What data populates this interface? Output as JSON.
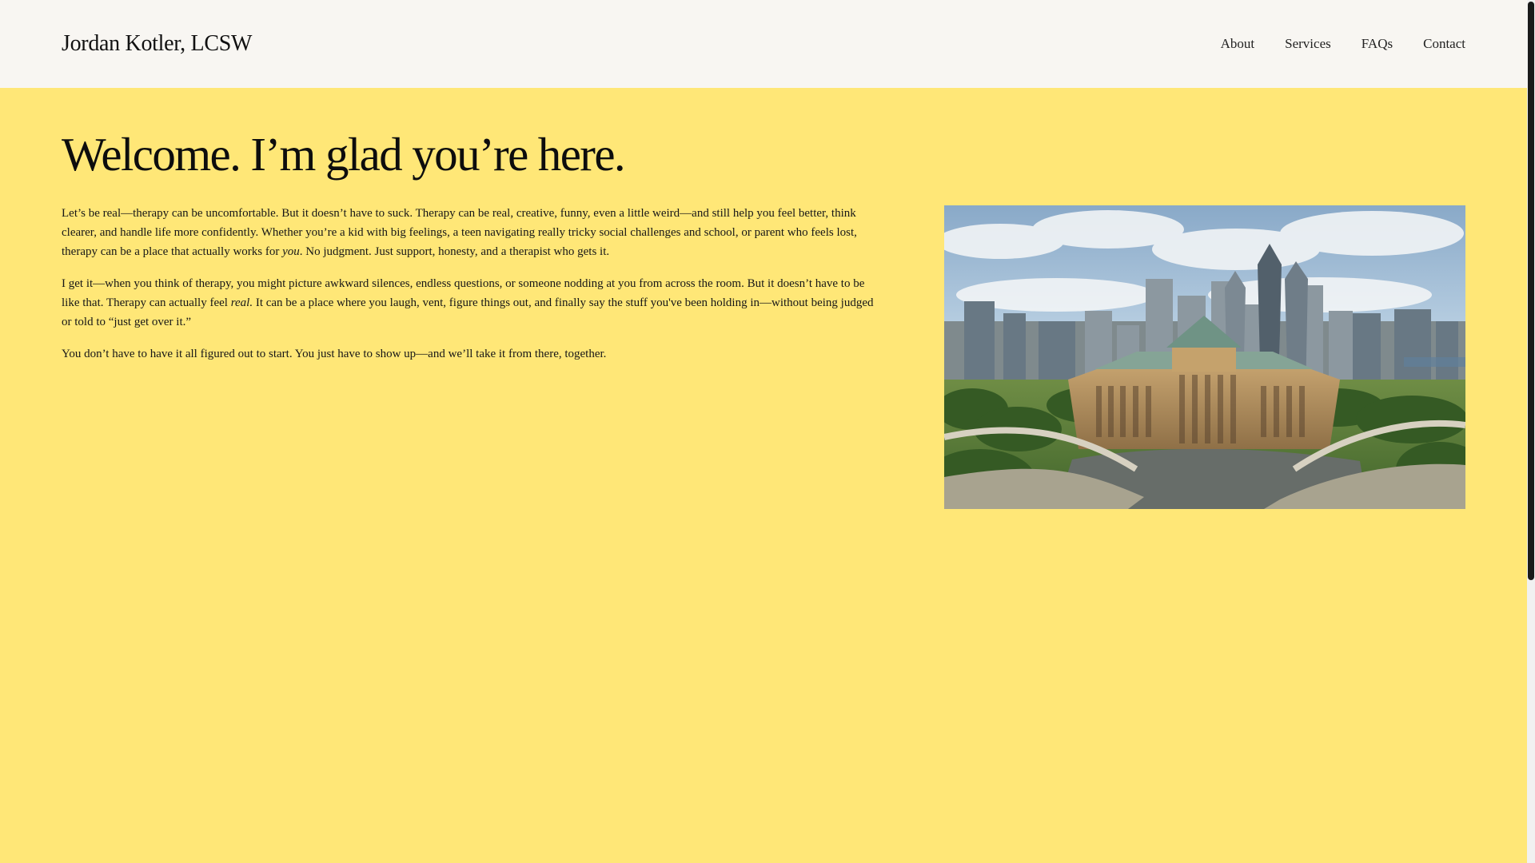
{
  "header": {
    "site_title": "Jordan Kotler, LCSW",
    "nav": [
      {
        "label": "About"
      },
      {
        "label": "Services"
      },
      {
        "label": "FAQs"
      },
      {
        "label": "Contact"
      }
    ]
  },
  "main": {
    "headline": "Welcome. I’m glad you’re here.",
    "paragraph_1": {
      "a": "Let’s be real—therapy  can be uncomfortable. But it doesn’t have to suck. Therapy can be real, creative, funny, even a little weird—and still help you feel better, think clearer, and handle life more confidently. Whether you’re a kid with big feelings, a teen navigating really tricky social challenges and school, or parent who feels lost, therapy can be a place that actually works for ",
      "emphasis": "you",
      "b": ". No judgment. Just support, honesty, and a therapist who gets it."
    },
    "paragraph_2": {
      "a": "I get it—when you think of therapy, you might picture awkward silences, endless questions, or someone nodding at you from across the room. But it doesn’t have to be like that. Therapy can actually feel ",
      "emphasis": "real.",
      "b": " It can be a place where you laugh, vent, figure things out, and finally say the stuff you've been holding in—without being judged or told to “just get over it.”"
    },
    "paragraph_3": "You don’t have to have it all figured out to start. You just have to show up—and we’ll take it from there, together."
  },
  "colors": {
    "page_background": "#ffe777",
    "header_background": "#f8f6f2",
    "text": "#111111"
  },
  "icons": {
    "hero_image": "philadelphia-skyline-photo"
  }
}
